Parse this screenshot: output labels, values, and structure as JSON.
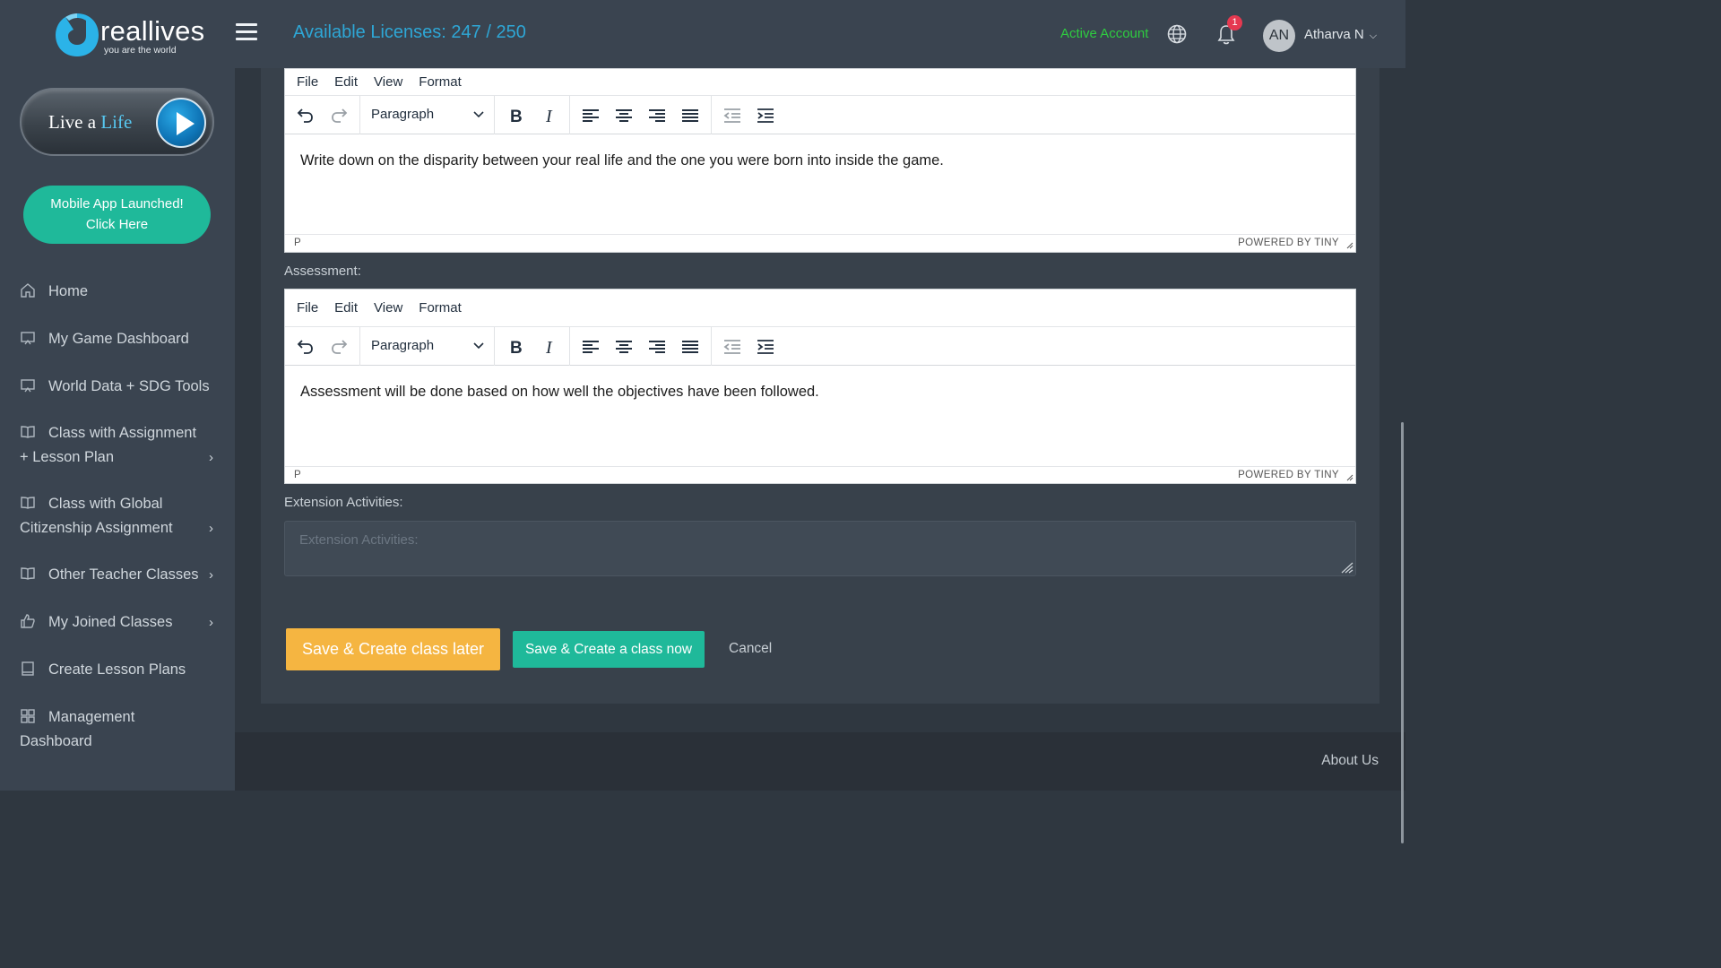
{
  "brand": {
    "name": "reallives",
    "tagline": "you are the world"
  },
  "sidebar": {
    "live_button": {
      "prefix": "Live a ",
      "highlight": "Life"
    },
    "mobile_line1": "Mobile App Launched!",
    "mobile_line2": "Click Here",
    "items": [
      {
        "label": "Home",
        "icon": "home-icon"
      },
      {
        "label": "My Game Dashboard",
        "icon": "monitor-icon"
      },
      {
        "label": "World Data + SDG Tools",
        "icon": "monitor-icon"
      },
      {
        "label_line1": "Class with Assignment",
        "label_line2": "+ Lesson Plan",
        "icon": "book-icon",
        "chevron": "›"
      },
      {
        "label_line1": "Class with Global",
        "label_line2": "Citizenship Assignment",
        "icon": "book-icon",
        "chevron": "›"
      },
      {
        "label": "Other Teacher Classes",
        "icon": "book-icon",
        "chevron": "›"
      },
      {
        "label": "My Joined Classes",
        "icon": "thumbs-up-icon",
        "chevron": "›"
      },
      {
        "label": "Create Lesson Plans",
        "icon": "notebook-icon"
      },
      {
        "label_line1": "Management",
        "label_line2": "Dashboard",
        "icon": "grid-icon"
      }
    ]
  },
  "topbar": {
    "licenses": "Available Licenses: 247 / 250",
    "active_account": "Active Account",
    "notification_count": "1",
    "avatar_initials": "AN",
    "user_name": "Atharva N",
    "colors": {
      "licenses": "#2ea7d6",
      "active": "#2ecc40",
      "badge": "#e53950"
    }
  },
  "editors": [
    {
      "menu": [
        "File",
        "Edit",
        "View",
        "Format"
      ],
      "block_format": "Paragraph",
      "content": "Write down on the disparity between your real life and the one you were born into inside the game.",
      "status_path": "P",
      "powered_by": "POWERED BY TINY"
    },
    {
      "label": "Assessment:",
      "menu": [
        "File",
        "Edit",
        "View",
        "Format"
      ],
      "block_format": "Paragraph",
      "content": "Assessment will be done based on how well the objectives have been followed.",
      "status_path": "P",
      "powered_by": "POWERED BY TINY"
    }
  ],
  "extension": {
    "label": "Extension Activities:",
    "placeholder": "Extension Activities:",
    "value": ""
  },
  "actions": {
    "save_later": "Save & Create class later",
    "save_now": "Save & Create a class now",
    "cancel": "Cancel",
    "colors": {
      "save_later": "#f5b541",
      "save_now": "#1fb99a"
    }
  },
  "footer": {
    "about": "About Us"
  }
}
